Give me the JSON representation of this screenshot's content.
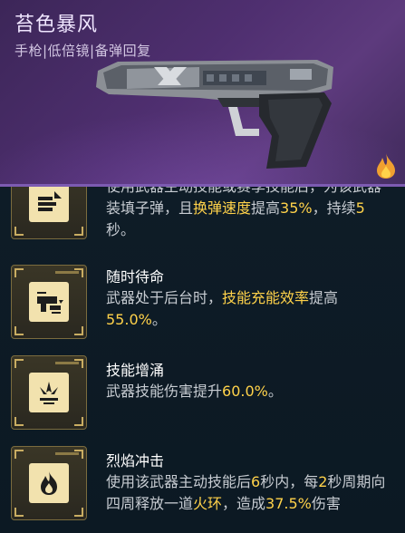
{
  "weapon": {
    "name": "苔色暴风",
    "subtitle": "手枪|低倍镜|备弹回复",
    "rarity_icon": "flame-icon",
    "accent_color": "#7d5bb2"
  },
  "perks": [
    {
      "icon": "ammo-reload-icon",
      "name": "",
      "desc_parts": [
        {
          "text": "使用武器主动技能或赛季技能后，",
          "hl": false
        },
        {
          "text": "为该武器装填子弹，且",
          "hl": false
        },
        {
          "text": "换弹速度",
          "hl": true
        },
        {
          "text": "提高",
          "hl": false
        },
        {
          "text": "35%",
          "hl": true
        },
        {
          "text": "，持续",
          "hl": false
        },
        {
          "text": "5",
          "hl": true
        },
        {
          "text": "秒。",
          "hl": false
        }
      ]
    },
    {
      "icon": "swap-weapon-icon",
      "name": "随时待命",
      "desc_parts": [
        {
          "text": "武器处于后台时，",
          "hl": false
        },
        {
          "text": "技能充能效率",
          "hl": true
        },
        {
          "text": "提高",
          "hl": false
        },
        {
          "text": "55.0%",
          "hl": true
        },
        {
          "text": "。",
          "hl": false
        }
      ]
    },
    {
      "icon": "skill-surge-icon",
      "name": "技能增涌",
      "desc_parts": [
        {
          "text": "武器技能伤害提升",
          "hl": false
        },
        {
          "text": "60.0%",
          "hl": true
        },
        {
          "text": "。",
          "hl": false
        }
      ]
    },
    {
      "icon": "flame-burst-icon",
      "name": "烈焰冲击",
      "desc_parts": [
        {
          "text": "使用该武器主动技能后",
          "hl": false
        },
        {
          "text": "6",
          "hl": true
        },
        {
          "text": "秒内，每",
          "hl": false
        },
        {
          "text": "2",
          "hl": true
        },
        {
          "text": "秒周期向四周释放一道",
          "hl": false
        },
        {
          "text": "火环",
          "hl": true
        },
        {
          "text": "，造成",
          "hl": false
        },
        {
          "text": "37.5%",
          "hl": true
        },
        {
          "text": "伤害",
          "hl": false
        }
      ]
    }
  ]
}
